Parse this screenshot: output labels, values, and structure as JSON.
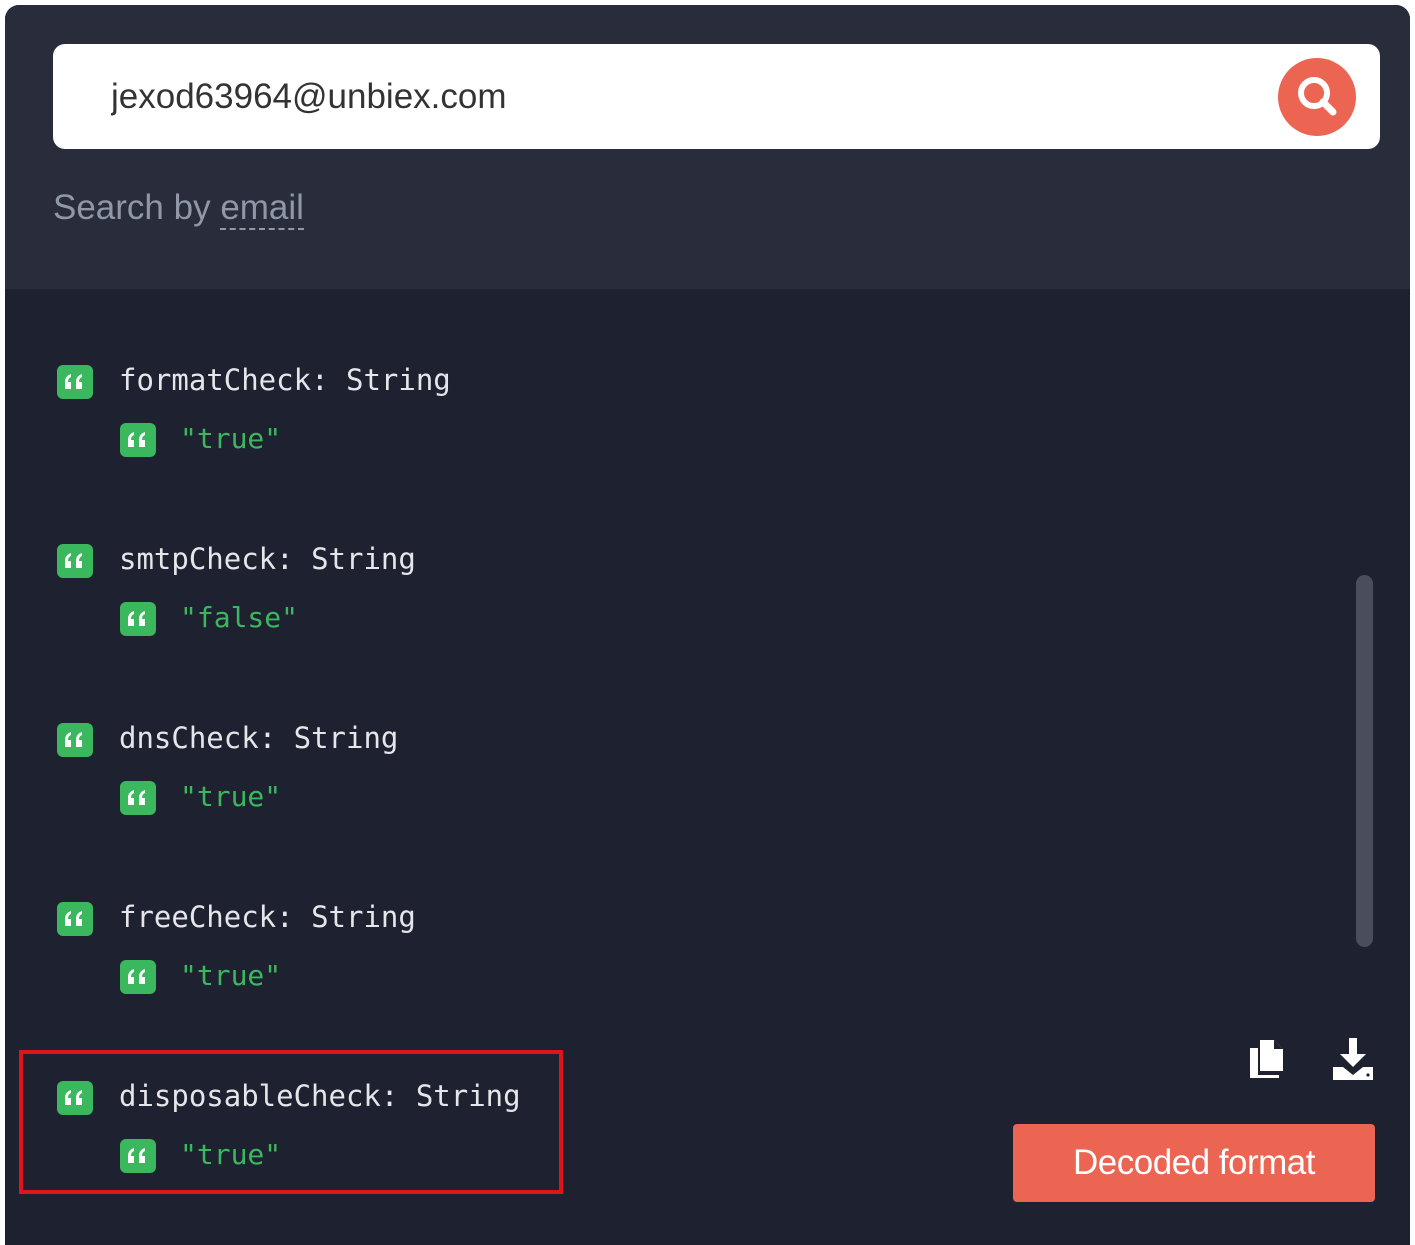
{
  "search": {
    "value": "jexod63964@unbiex.com",
    "hint_prefix": "Search by ",
    "hint_link": "email"
  },
  "entries": [
    {
      "key": "formatCheck",
      "type": "String",
      "value": "\"true\""
    },
    {
      "key": "smtpCheck",
      "type": "String",
      "value": "\"false\""
    },
    {
      "key": "dnsCheck",
      "type": "String",
      "value": "\"true\""
    },
    {
      "key": "freeCheck",
      "type": "String",
      "value": "\"true\""
    },
    {
      "key": "disposableCheck",
      "type": "String",
      "value": "\"true\""
    }
  ],
  "actions": {
    "decoded_label": "Decoded format",
    "copy_icon": "copy-icon",
    "download_icon": "download-icon"
  },
  "colors": {
    "accent": "#ec6452",
    "string_green": "#3bb75e",
    "panel_bg": "#1e2130",
    "highlight_red": "#e0141b"
  }
}
